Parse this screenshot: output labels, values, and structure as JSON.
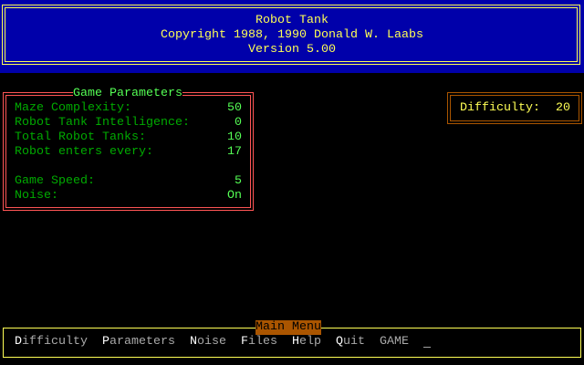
{
  "header": {
    "title": "Robot Tank",
    "copyright": "Copyright 1988, 1990 Donald W. Laabs",
    "version": "Version 5.00"
  },
  "parameters": {
    "title": "Game Parameters",
    "rows": [
      {
        "label": "Maze Complexity:",
        "value": "50"
      },
      {
        "label": "Robot Tank Intelligence:",
        "value": "0"
      },
      {
        "label": "Total Robot Tanks:",
        "value": "10"
      },
      {
        "label": "Robot enters every:",
        "value": "17"
      },
      {
        "label": "Game Speed:",
        "value": "5"
      },
      {
        "label": "Noise:",
        "value": "On"
      }
    ]
  },
  "difficulty": {
    "label": "Difficulty:",
    "value": "20"
  },
  "menu": {
    "title": "Main Menu",
    "items": [
      {
        "hotkey": "D",
        "rest": "ifficulty"
      },
      {
        "hotkey": "P",
        "rest": "arameters"
      },
      {
        "hotkey": "N",
        "rest": "oise"
      },
      {
        "hotkey": "F",
        "rest": "iles"
      },
      {
        "hotkey": "H",
        "rest": "elp"
      },
      {
        "hotkey": "Q",
        "rest": "uit"
      },
      {
        "hotkey": "",
        "rest": "GAME"
      }
    ],
    "cursor": "_"
  },
  "colors": {
    "header_bg": "#0000aa",
    "header_text": "#ffff55",
    "params_border": "#ff5555",
    "label": "#00aa00",
    "value": "#55ff55",
    "difficulty_border": "#aa5500",
    "menu_border": "#ffff55"
  }
}
